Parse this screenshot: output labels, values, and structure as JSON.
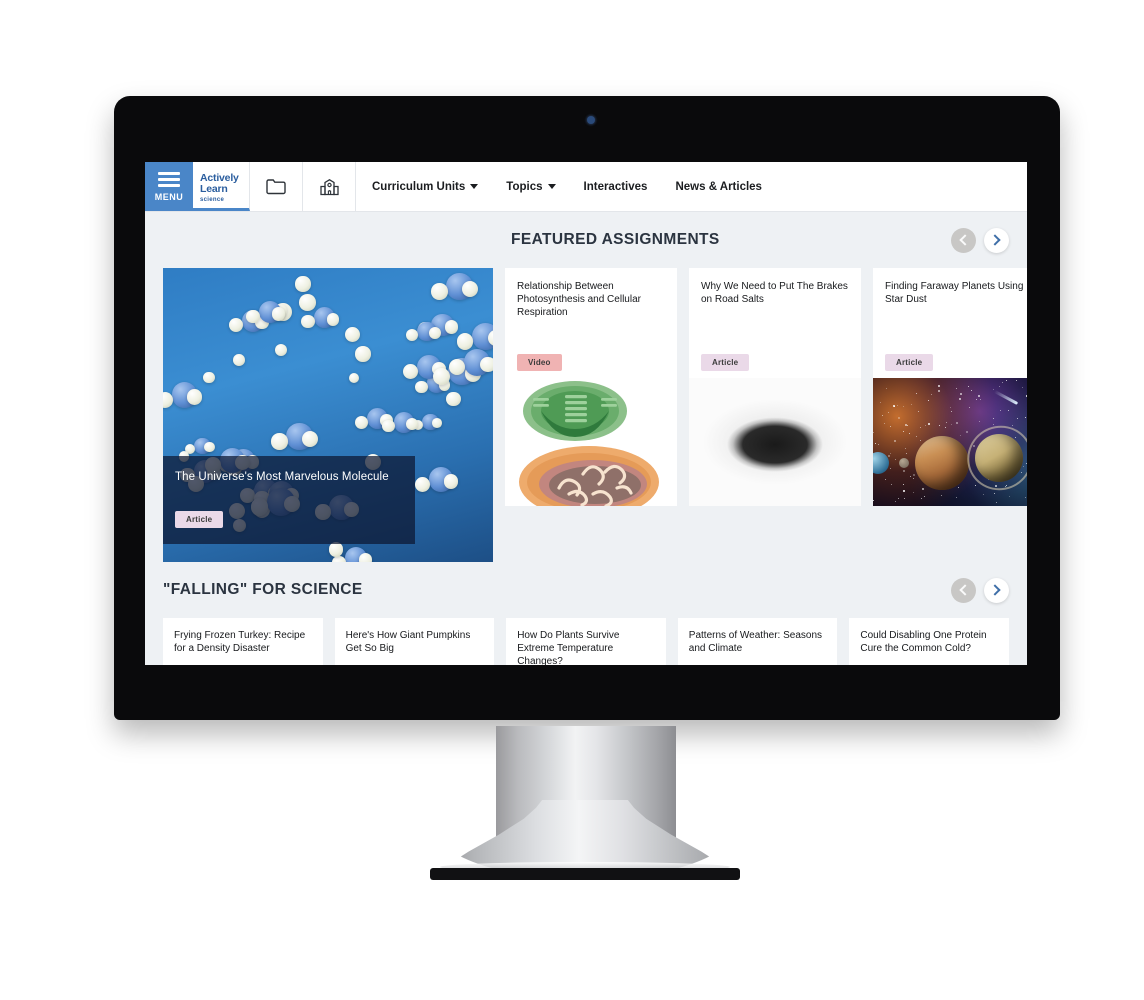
{
  "nav": {
    "menu_label": "MENU",
    "brand": {
      "line1": "Actively",
      "line2": "Learn",
      "subject": "science"
    },
    "icons": [
      {
        "name": "folder-icon"
      },
      {
        "name": "school-building-icon"
      }
    ],
    "links": [
      {
        "label": "Curriculum Units",
        "has_caret": true
      },
      {
        "label": "Topics",
        "has_caret": true
      },
      {
        "label": "Interactives",
        "has_caret": false
      },
      {
        "label": "News & Articles",
        "has_caret": false
      }
    ]
  },
  "featured": {
    "title": "FEATURED ASSIGNMENTS",
    "prev_label": "Previous",
    "next_label": "Next",
    "hero": {
      "title": "The Universe's Most Marvelous Molecule",
      "tag": "Article",
      "image_alt": "water-molecules-illustration"
    },
    "cards": [
      {
        "title": "Relationship Between Photosynthesis and Cellular Respiration",
        "tag": "Video",
        "image_alt": "chloroplast-and-mitochondrion-illustration"
      },
      {
        "title": "Why We Need to Put The Brakes on Road Salts",
        "tag": "Article",
        "image_alt": "road-salt-in-snow-photo"
      },
      {
        "title": "Finding Faraway Planets Using Star Dust",
        "tag": "Article",
        "image_alt": "planets-in-space-photo"
      }
    ]
  },
  "falling": {
    "title": "\"FALLING\" FOR SCIENCE",
    "prev_label": "Previous",
    "next_label": "Next",
    "cards": [
      {
        "title": "Frying Frozen Turkey: Recipe for a Density Disaster"
      },
      {
        "title": "Here's How Giant Pumpkins Get So Big"
      },
      {
        "title": "How Do Plants Survive Extreme Temperature Changes?"
      },
      {
        "title": "Patterns of Weather: Seasons and Climate"
      },
      {
        "title": "Could Disabling One Protein Cure the Common Cold?"
      }
    ]
  },
  "colors": {
    "brand_blue": "#4a86c8",
    "brand_text": "#2a5d9e",
    "page_bg": "#eef1f4",
    "heading": "#2b3440",
    "tag_article_bg": "#ead9e8",
    "tag_video_bg": "#f0b3b3",
    "bezel": "#0a0a0c"
  }
}
